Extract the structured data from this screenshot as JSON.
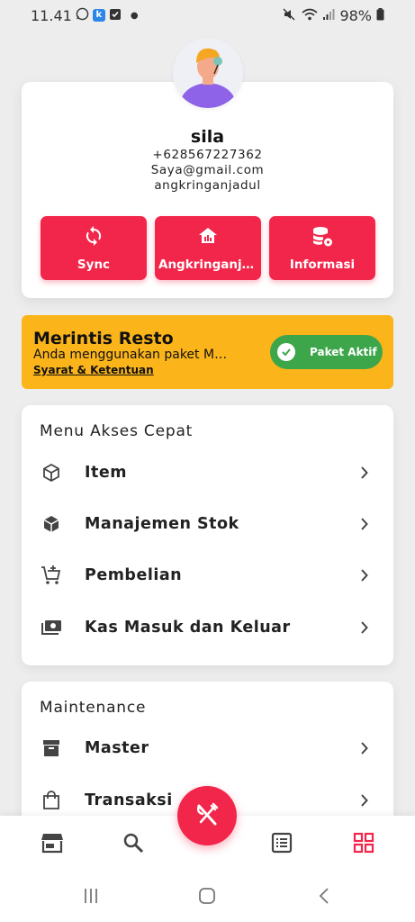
{
  "status_bar": {
    "time": "11.41",
    "battery": "98%"
  },
  "profile": {
    "name": "sila",
    "phone": "+628567227362",
    "email": "Saya@gmail.com",
    "store": "angkringanjadul",
    "actions": [
      {
        "label": "Sync",
        "icon": "sync-icon"
      },
      {
        "label": "Angkringanjadul",
        "icon": "store-chart-icon"
      },
      {
        "label": "Informasi",
        "icon": "database-settings-icon"
      }
    ]
  },
  "banner": {
    "title": "Merintis Resto",
    "description": "Anda menggunakan paket Merintis Resto",
    "link": "Syarat & Ketentuan",
    "status_label": "Paket Aktif",
    "color": "#fbb41a",
    "status_color": "#3da64a"
  },
  "quick_menu": {
    "title": "Menu Akses Cepat",
    "items": [
      {
        "label": "Item",
        "icon": "box-icon"
      },
      {
        "label": "Manajemen Stok",
        "icon": "stock-box-icon"
      },
      {
        "label": "Pembelian",
        "icon": "cart-plus-icon"
      },
      {
        "label": "Kas Masuk dan Keluar",
        "icon": "cash-icon"
      }
    ]
  },
  "maintenance": {
    "title": "Maintenance",
    "items": [
      {
        "label": "Master",
        "icon": "archive-icon"
      },
      {
        "label": "Transaksi",
        "icon": "shopping-bag-icon"
      }
    ]
  },
  "bottom_nav": {
    "items": [
      "store-icon",
      "search-icon",
      "utensils-icon",
      "list-icon",
      "grid-icon"
    ],
    "active": "grid-icon"
  },
  "colors": {
    "accent": "#f2264a",
    "background": "#ededed"
  }
}
